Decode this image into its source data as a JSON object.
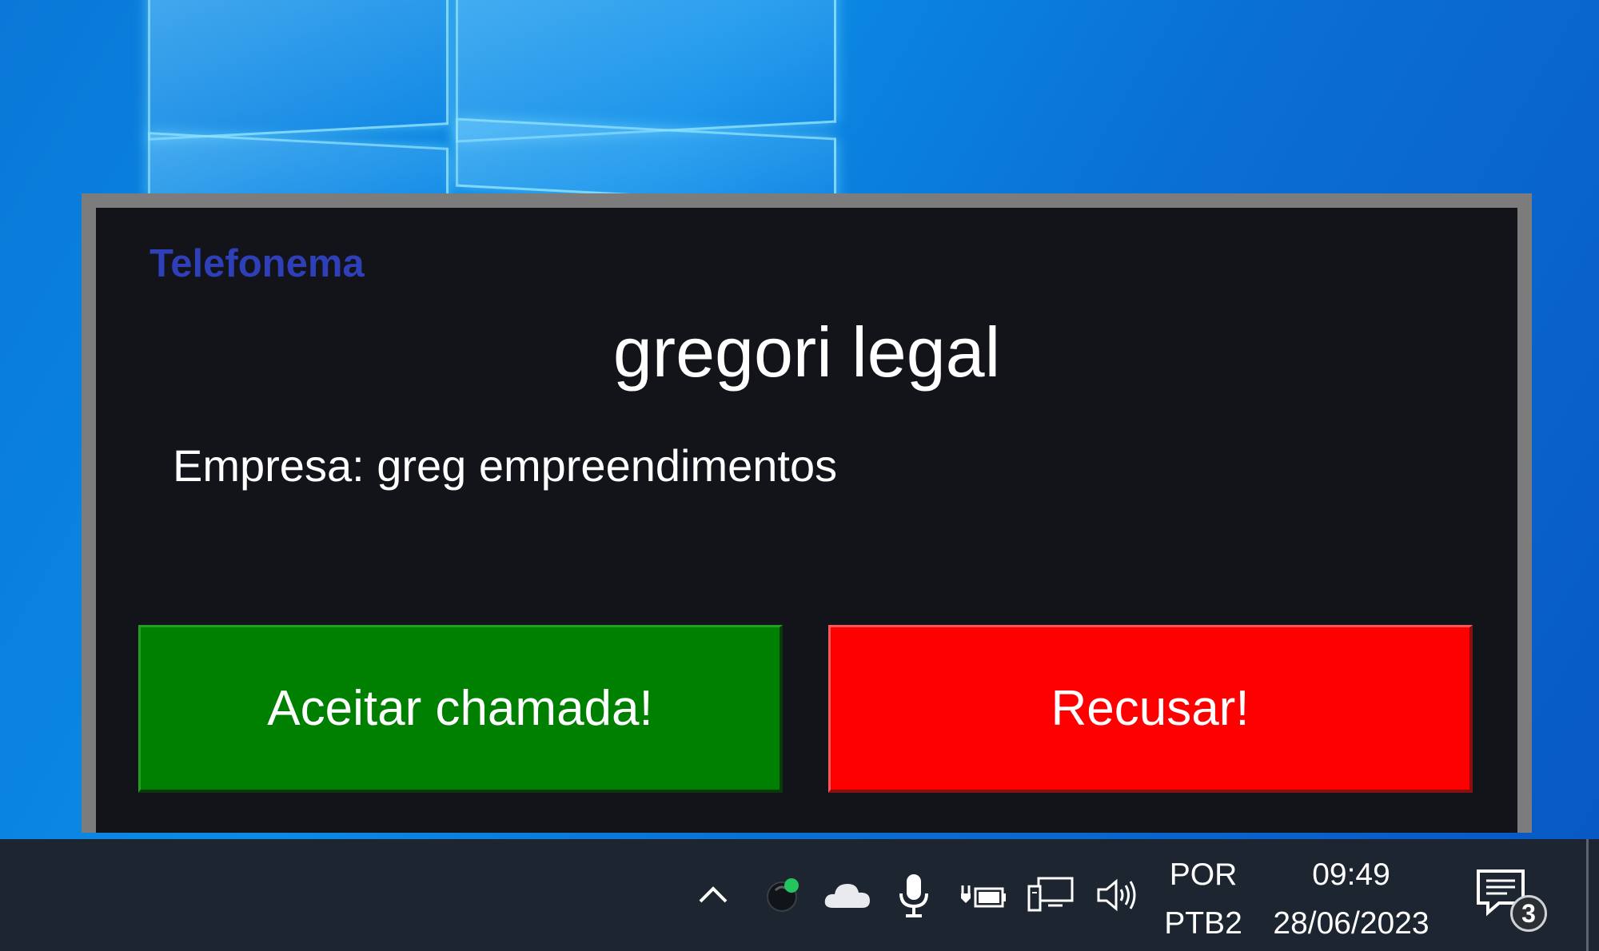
{
  "popup": {
    "title": "Telefonema",
    "caller_name": "gregori legal",
    "company_line": "Empresa: greg empreendimentos",
    "accept_label": "Aceitar chamada!",
    "decline_label": "Recusar!"
  },
  "taskbar": {
    "language_top": "POR",
    "language_bottom": "PTB2",
    "time": "09:49",
    "date": "28/06/2023",
    "notification_count": "3",
    "tray_icons": [
      "chevron-up-icon",
      "app-status-icon",
      "onedrive-cloud-icon",
      "microphone-icon",
      "power-plug-icon",
      "network-icon",
      "volume-icon"
    ]
  },
  "colors": {
    "title_blue": "#2f3fb8",
    "accept_green": "#008000",
    "decline_red": "#ff0000",
    "popup_bg": "#12141a",
    "popup_border": "#7c7c7c",
    "taskbar_bg": "#1c2530"
  }
}
